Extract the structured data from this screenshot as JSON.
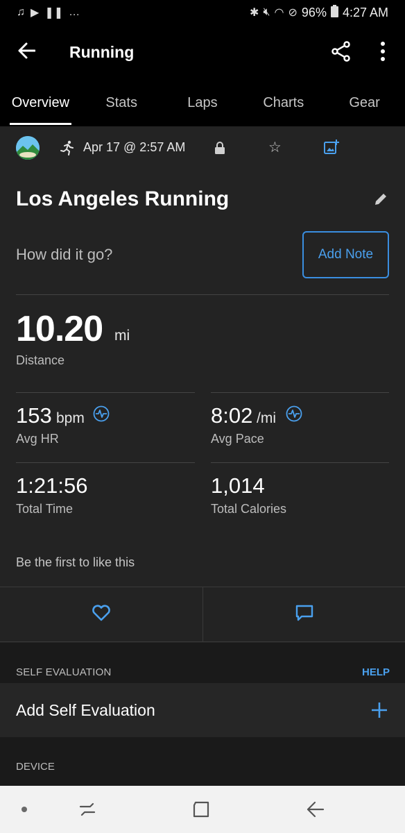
{
  "status_bar": {
    "battery": "96%",
    "time": "4:27 AM",
    "left_glyphs": "…"
  },
  "app_bar": {
    "title": "Running"
  },
  "tabs": [
    {
      "label": "Overview",
      "active": true
    },
    {
      "label": "Stats",
      "active": false
    },
    {
      "label": "Laps",
      "active": false
    },
    {
      "label": "Charts",
      "active": false
    },
    {
      "label": "Gear",
      "active": false
    }
  ],
  "activity": {
    "date": "Apr 17 @ 2:57 AM",
    "title": "Los Angeles Running",
    "note_prompt": "How did it go?",
    "add_note_label": "Add Note"
  },
  "stats": {
    "distance": {
      "value": "10.20",
      "unit": "mi",
      "label": "Distance"
    },
    "avg_hr": {
      "value": "153",
      "unit": "bpm",
      "label": "Avg HR"
    },
    "avg_pace": {
      "value": "8:02",
      "unit": "/mi",
      "label": "Avg Pace"
    },
    "total_time": {
      "value": "1:21:56",
      "label": "Total Time"
    },
    "total_calories": {
      "value": "1,014",
      "label": "Total Calories"
    }
  },
  "social": {
    "likes_text": "Be the first to like this"
  },
  "self_evaluation": {
    "header": "SELF EVALUATION",
    "help_label": "HELP",
    "add_label": "Add Self Evaluation"
  },
  "device": {
    "header": "DEVICE"
  },
  "colors": {
    "accent": "#4aa0ee",
    "background": "#232323",
    "section_gap": "#1a1a1a"
  }
}
